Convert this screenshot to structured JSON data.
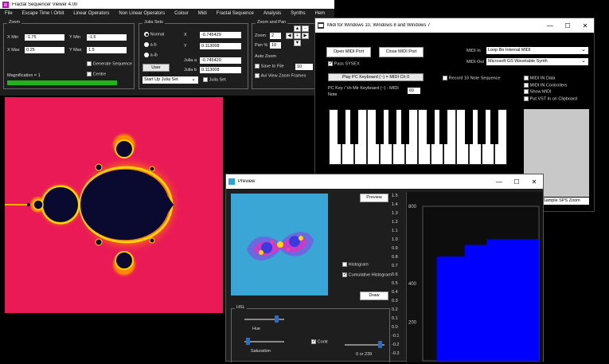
{
  "main": {
    "title": "Fractal Sequencer Viewer 4.00",
    "menu": [
      "File",
      "Escape Time \\ Orbit",
      "Linear Operators",
      "Non Linear Operators",
      "Colour",
      "Midi",
      "Fractal Sequence",
      "Analysis",
      "Synths",
      "Hem"
    ],
    "zoom": {
      "title": "Zoom",
      "xmin_label": "X Min",
      "xmin": "-1.75",
      "ymin_label": "Y Min",
      "ymin": "-1.5",
      "xmax_label": "X Max",
      "xmax": "0.25",
      "ymax_label": "Y Max",
      "ymax": "1.5",
      "generate_label": "Generate Sequence",
      "centre_label": "Centre",
      "magnification": "Magnification = 1"
    },
    "julia": {
      "title": "Julia Sets",
      "options": [
        "Normal",
        "a-b",
        "a-ib"
      ],
      "x_label": "X",
      "x_val": "-0.745429",
      "y_label": "Y",
      "y_val": "0.113008",
      "julia_a_label": "Julia a",
      "julia_a": "-0.745429",
      "julia_b_label": "Julia b",
      "julia_b": "0.113008",
      "user_defined": "User Defined",
      "start_select": "Start Up Julia Set",
      "julia_set_label": "Julia Set"
    },
    "zoom_pan": {
      "title": "Zoom and Pan",
      "zoom_label": "Zoom",
      "zoom_val": "2",
      "pan_label": "Pan %",
      "pan_val": "10",
      "auto_label": "Auto Zoom",
      "save_label": "Save to File",
      "frames_val": "10",
      "avi_label": "Avi View Zoom Frames"
    }
  },
  "midi": {
    "title": "Midi for Windows 10, Windows 8 and Windows 7",
    "open_btn": "Open MIDI Port",
    "close_btn": "Close MIDI Port",
    "midi_in_label": "MIDI In",
    "midi_in": "Loop Be Internal MIDI",
    "midi_out_label": "MIDI Out",
    "midi_out": "Microsoft GS Wavetable Synth",
    "pass_sysex": "Pass SYSEX",
    "keyboard_btn": "Play PC Keyboard (~) = MIDI Ch 0",
    "record_label": "Record 16 Note Sequence",
    "key_text": "PC Key / Vo Mir Keyboard (~) - MIDI",
    "note_label": "Note",
    "note_val": "60",
    "checks": [
      "MIDI IN Data",
      "MIDI IN Controllers",
      "Show MIDI",
      "Put VST In on Clipboard"
    ],
    "bottom_field": "Sample SPS Zoom"
  },
  "preview": {
    "title": "Preview",
    "preview_btn": "Preview",
    "histogram_label": "Histogram",
    "cumulative_label": "Cumulative Histogram",
    "draw_btn": "Draw",
    "hsl_title": "HSL",
    "hue_label": "Hue",
    "saturation_label": "Saturation",
    "contr_label": "Contr",
    "contr_val": "0 or 239",
    "scale_ticks": [
      "1.5",
      "1.4",
      "1.3",
      "1.2",
      "1.1",
      "1.0",
      "0.9",
      "0.8",
      "0.7",
      "0.6",
      "0.5",
      "0.4",
      "0.3",
      "0.2",
      "0.1",
      "0.0",
      "-0.1",
      "-0.2",
      "-0.3"
    ]
  },
  "chart_data": {
    "type": "area",
    "ylim": [
      0,
      800
    ],
    "ytick_labels": [
      "800",
      "400",
      "200"
    ],
    "values": [
      0,
      0,
      0,
      0,
      0,
      0,
      0,
      0,
      0,
      0,
      0,
      0,
      0,
      0,
      0,
      0,
      0,
      0,
      0,
      0,
      0,
      0,
      0,
      0,
      0,
      0,
      0,
      0,
      0,
      0,
      0,
      0,
      0,
      0,
      0,
      0,
      0,
      0,
      0,
      0,
      0,
      0,
      0,
      0,
      0,
      0,
      0,
      0,
      0,
      0,
      0,
      0,
      0,
      0,
      0,
      0,
      0,
      0,
      0,
      0,
      0,
      0,
      0,
      0,
      0,
      0,
      0,
      0,
      0,
      0,
      0,
      0,
      0,
      0,
      0,
      0,
      0,
      0,
      0,
      0,
      0,
      0,
      0,
      0,
      0,
      0,
      0,
      0,
      0,
      0,
      0,
      0,
      0,
      0,
      0,
      0,
      0,
      0,
      0,
      0,
      0,
      0,
      0,
      0,
      0,
      0,
      0,
      0,
      0,
      0,
      0,
      0,
      0,
      0,
      0,
      0,
      0,
      0,
      0,
      0,
      0,
      0,
      0,
      0,
      0,
      0,
      0,
      0,
      0,
      0,
      0,
      0,
      0,
      0,
      0,
      0,
      0,
      0,
      0,
      0,
      0,
      0,
      0,
      0,
      0,
      0,
      0,
      0,
      0,
      0
    ],
    "steps": [
      {
        "from": 0.0,
        "to": 0.12,
        "value": 0
      },
      {
        "from": 0.12,
        "to": 0.36,
        "value": 540
      },
      {
        "from": 0.36,
        "to": 0.55,
        "value": 600
      },
      {
        "from": 0.55,
        "to": 1.0,
        "value": 630
      }
    ],
    "color": "#0000ff"
  },
  "colors": {
    "mandel_bg": "#ea1a56",
    "mandel_set": "#0a0a30",
    "accent_green": "#1fb31f"
  }
}
